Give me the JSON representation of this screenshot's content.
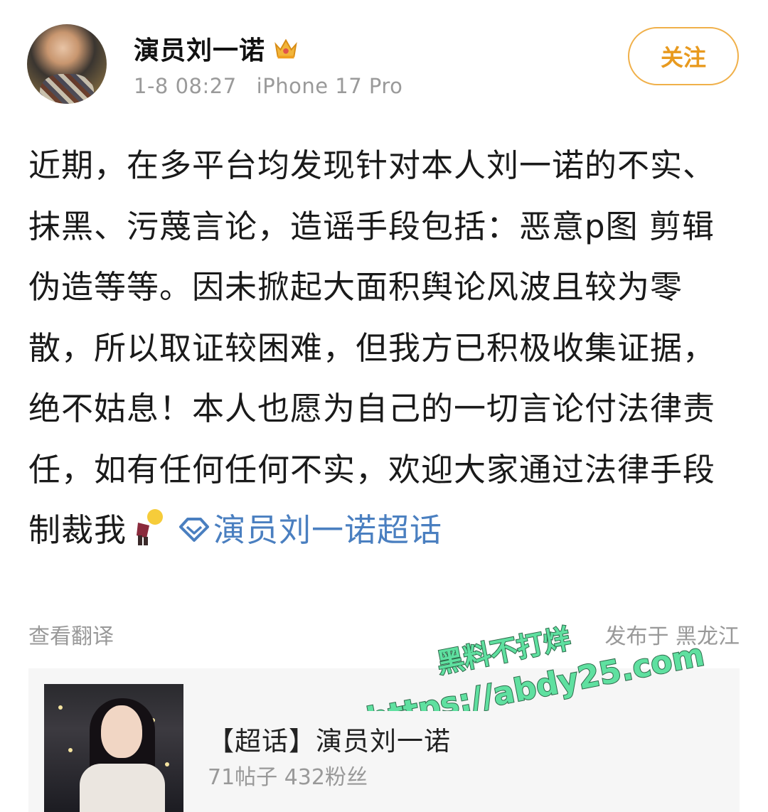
{
  "header": {
    "username": "演员刘一诺",
    "time": "1-8 08:27",
    "device": "iPhone 17 Pro",
    "follow_label": "关注"
  },
  "post": {
    "text": "近期，在多平台均发现针对本人刘一诺的不实、抹黑、污蔑言论，造谣手段包括：恶意p图 剪辑 伪造等等。因未掀起大面积舆论风波且较为零散，所以取证较困难，但我方已积极收集证据，绝不姑息！本人也愿为自己的一切言论付法律责任，如有任何任何不实，欢迎大家通过法律手段制裁我",
    "topic_link": "演员刘一诺超话",
    "translate_label": "查看翻译",
    "location_label": "发布于 黑龙江"
  },
  "watermark": {
    "line1": "黑料不打烊",
    "line2": "https://abdy25.com"
  },
  "card": {
    "title": "【超话】演员刘一诺",
    "stats": "71帖子 432粉丝"
  },
  "colors": {
    "follow": "#e89a1f",
    "link": "#4a7fc0",
    "watermark_fill": "#5fe0a0",
    "watermark_stroke": "#2d6a4a"
  }
}
